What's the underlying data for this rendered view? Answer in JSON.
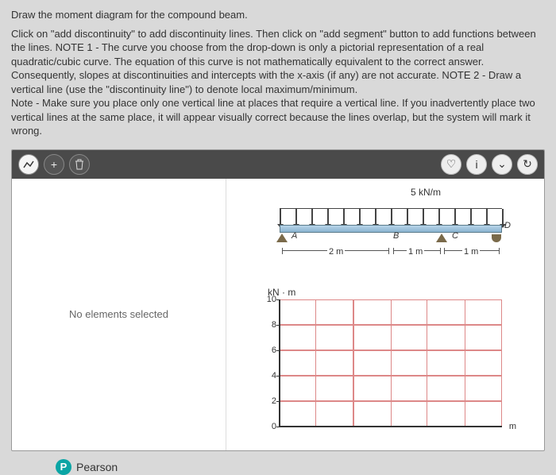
{
  "instructions": {
    "title": "Draw the moment diagram for the compound beam.",
    "body": "Click on \"add discontinuity\" to add discontinuity lines. Then click on \"add segment\" button to add functions between the lines. NOTE 1 - The curve you choose from the drop-down is only a pictorial representation of a real quadratic/cubic curve. The equation of this curve is not mathematically equivalent to the correct answer. Consequently, slopes at discontinuities and intercepts with the x-axis (if any) are not accurate. NOTE 2 - Draw a vertical line (use the \"discontinuity line\") to denote local maximum/minimum.",
    "note": "Note - Make sure you place only one vertical line at places that require a vertical line. If you inadvertently place two vertical lines at the same place, it will appear visually correct because the lines overlap, but the system will mark it wrong."
  },
  "panel": {
    "noSelection": "No elements selected"
  },
  "beam": {
    "loadLabel": "5 kN/m",
    "points": {
      "A": "A",
      "B": "B",
      "C": "C",
      "D": "D"
    },
    "dims": {
      "d1": "2 m",
      "d2": "1 m",
      "d3": "1 m"
    }
  },
  "chart_data": {
    "type": "line",
    "title": "",
    "xlabel": "m",
    "ylabel": "kN · m",
    "ylim": [
      0,
      10
    ],
    "yticks": [
      0,
      2,
      4,
      6,
      8,
      10
    ],
    "series": []
  },
  "footer": {
    "brand": "Pearson",
    "iconLetter": "P"
  }
}
